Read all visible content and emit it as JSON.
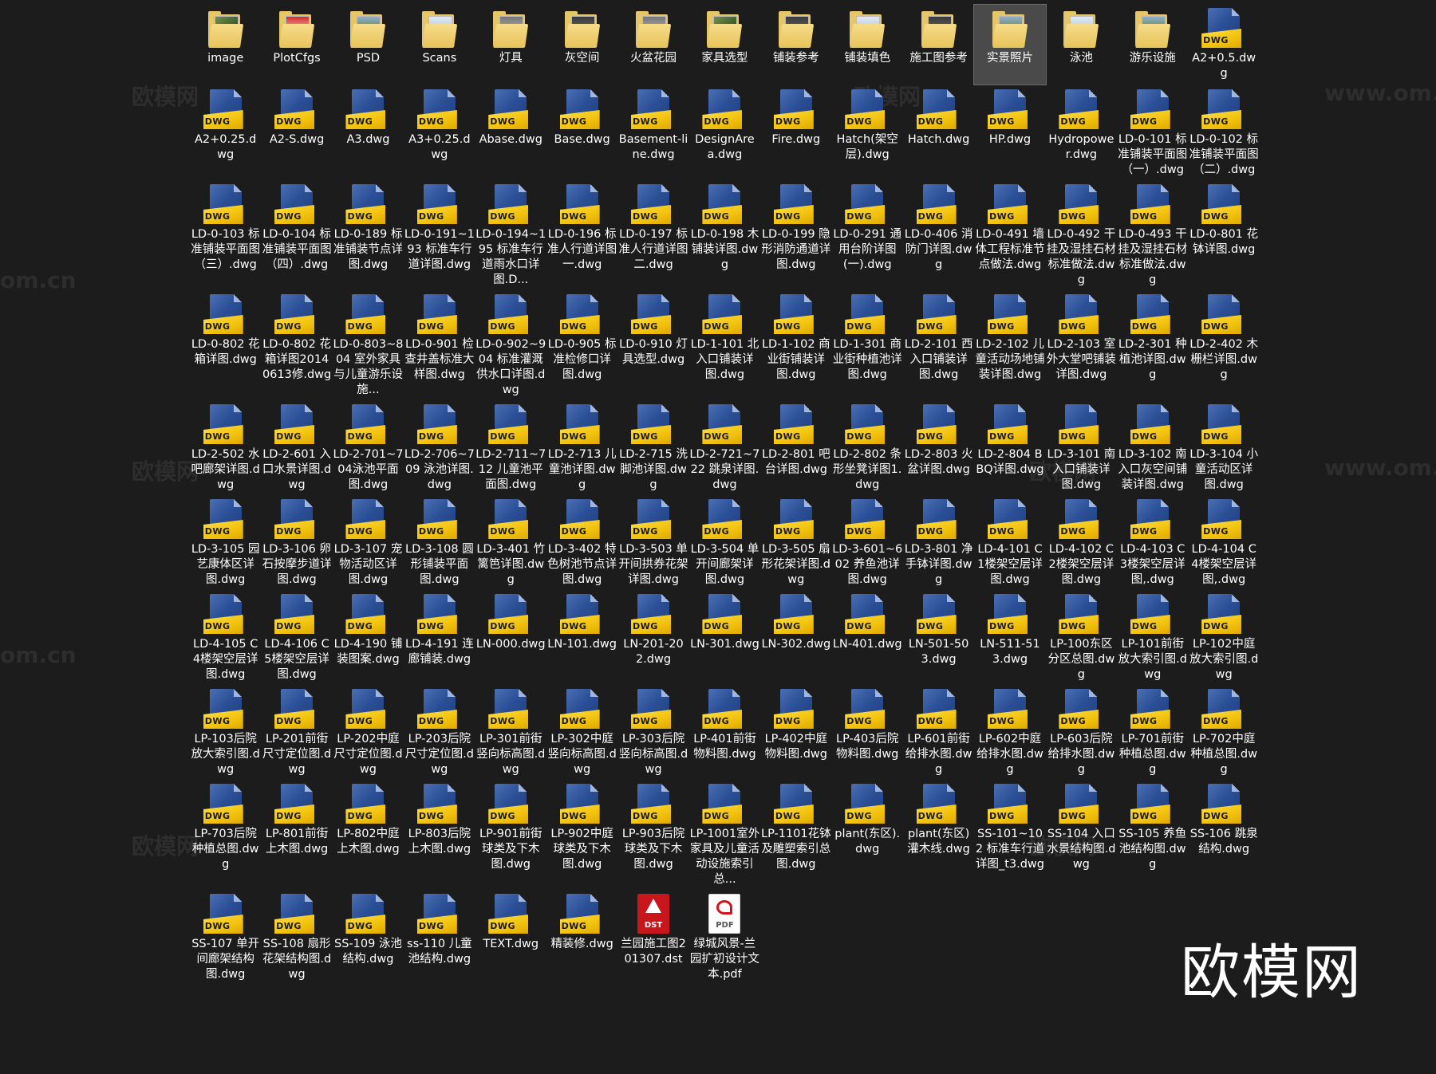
{
  "watermarks": [
    "欧模网",
    "www.om.cn",
    "om.cn"
  ],
  "brand_logo_text": "欧模网",
  "files": [
    {
      "name": "image",
      "type": "folder",
      "thumb": "green"
    },
    {
      "name": "PlotCfgs",
      "type": "folder",
      "thumb": "red"
    },
    {
      "name": "PSD",
      "type": "folder",
      "thumb": "photo"
    },
    {
      "name": "Scans",
      "type": "folder",
      "thumb": "blue"
    },
    {
      "name": "灯具",
      "type": "folder",
      "thumb": "gray"
    },
    {
      "name": "灰空间",
      "type": "folder",
      "thumb": "dark"
    },
    {
      "name": "火盆花园",
      "type": "folder",
      "thumb": "gray"
    },
    {
      "name": "家具选型",
      "type": "folder",
      "thumb": "green"
    },
    {
      "name": "铺装参考",
      "type": "folder",
      "thumb": "dark"
    },
    {
      "name": "铺装填色",
      "type": "folder",
      "thumb": "blue"
    },
    {
      "name": "施工图参考",
      "type": "folder",
      "thumb": "dark"
    },
    {
      "name": "实景照片",
      "type": "folder",
      "thumb": "photo",
      "selected": true
    },
    {
      "name": "泳池",
      "type": "folder",
      "thumb": "blue"
    },
    {
      "name": "游乐设施",
      "type": "folder",
      "thumb": "photo"
    },
    {
      "name": "A2+0.5.dwg",
      "type": "dwg"
    },
    {
      "name": "A2+0.25.dwg",
      "type": "dwg"
    },
    {
      "name": "A2-S.dwg",
      "type": "dwg"
    },
    {
      "name": "A3.dwg",
      "type": "dwg"
    },
    {
      "name": "A3+0.25.dwg",
      "type": "dwg"
    },
    {
      "name": "Abase.dwg",
      "type": "dwg"
    },
    {
      "name": "Base.dwg",
      "type": "dwg"
    },
    {
      "name": "Basement-line.dwg",
      "type": "dwg"
    },
    {
      "name": "DesignArea.dwg",
      "type": "dwg"
    },
    {
      "name": "Fire.dwg",
      "type": "dwg"
    },
    {
      "name": "Hatch(架空层).dwg",
      "type": "dwg"
    },
    {
      "name": "Hatch.dwg",
      "type": "dwg"
    },
    {
      "name": "HP.dwg",
      "type": "dwg"
    },
    {
      "name": "Hydropower.dwg",
      "type": "dwg"
    },
    {
      "name": "LD-0-101 标准铺装平面图（一）.dwg",
      "type": "dwg"
    },
    {
      "name": "LD-0-102 标准铺装平面图（二）.dwg",
      "type": "dwg"
    },
    {
      "name": "LD-0-103 标准铺装平面图（三）.dwg",
      "type": "dwg"
    },
    {
      "name": "LD-0-104 标准铺装平面图（四）.dwg",
      "type": "dwg"
    },
    {
      "name": "LD-0-189 标准铺装节点详图.dwg",
      "type": "dwg"
    },
    {
      "name": "LD-0-191~193 标准车行道详图.dwg",
      "type": "dwg"
    },
    {
      "name": "LD-0-194~195 标准车行道雨水口详图.D...",
      "type": "dwg"
    },
    {
      "name": "LD-0-196 标准人行道详图一.dwg",
      "type": "dwg"
    },
    {
      "name": "LD-0-197 标准人行道详图二.dwg",
      "type": "dwg"
    },
    {
      "name": "LD-0-198 木铺装详图.dwg",
      "type": "dwg"
    },
    {
      "name": "LD-0-199 隐形消防通道详图.dwg",
      "type": "dwg"
    },
    {
      "name": "LD-0-291 通用台阶详图(一).dwg",
      "type": "dwg"
    },
    {
      "name": "LD-0-406 消防门详图.dwg",
      "type": "dwg"
    },
    {
      "name": "LD-0-491 墙体工程标准节点做法.dwg",
      "type": "dwg"
    },
    {
      "name": "LD-0-492 干挂及湿挂石材标准做法.dwg",
      "type": "dwg"
    },
    {
      "name": "LD-0-493 干挂及湿挂石材标准做法.dwg",
      "type": "dwg"
    },
    {
      "name": "LD-0-801 花钵详图.dwg",
      "type": "dwg"
    },
    {
      "name": "LD-0-802 花箱详图.dwg",
      "type": "dwg"
    },
    {
      "name": "LD-0-802 花箱详图20140613修.dwg",
      "type": "dwg"
    },
    {
      "name": "LD-0-803~804 室外家具与儿童游乐设施...",
      "type": "dwg"
    },
    {
      "name": "LD-0-901 检查井盖标准大样图.dwg",
      "type": "dwg"
    },
    {
      "name": "LD-0-902~904 标准灌溉供水口详图.dwg",
      "type": "dwg"
    },
    {
      "name": "LD-0-905 标准检修口详图.dwg",
      "type": "dwg"
    },
    {
      "name": "LD-0-910 灯具选型.dwg",
      "type": "dwg"
    },
    {
      "name": "LD-1-101 北入口铺装详图.dwg",
      "type": "dwg"
    },
    {
      "name": "LD-1-102 商业街铺装详图.dwg",
      "type": "dwg"
    },
    {
      "name": "LD-1-301 商业街种植池详图.dwg",
      "type": "dwg"
    },
    {
      "name": "LD-2-101 西入口铺装详图.dwg",
      "type": "dwg"
    },
    {
      "name": "LD-2-102 儿童活动场地铺装详图.dwg",
      "type": "dwg"
    },
    {
      "name": "LD-2-103 室外大堂吧铺装详图.dwg",
      "type": "dwg"
    },
    {
      "name": "LD-2-301 种植池详图.dwg",
      "type": "dwg"
    },
    {
      "name": "LD-2-402 木栅栏详图.dwg",
      "type": "dwg"
    },
    {
      "name": "LD-2-502 水吧廊架详图.dwg",
      "type": "dwg"
    },
    {
      "name": "LD-2-601 入口水景详图.dwg",
      "type": "dwg"
    },
    {
      "name": "LD-2-701~704泳池平面图.dwg",
      "type": "dwg"
    },
    {
      "name": "LD-2-706~709 泳池详图.dwg",
      "type": "dwg"
    },
    {
      "name": "LD-2-711~712 儿童池平面图.dwg",
      "type": "dwg"
    },
    {
      "name": "LD-2-713 儿童池详图.dwg",
      "type": "dwg"
    },
    {
      "name": "LD-2-715 洗脚池详图.dwg",
      "type": "dwg"
    },
    {
      "name": "LD-2-721~722 跳泉详图.dwg",
      "type": "dwg"
    },
    {
      "name": "LD-2-801 吧台详图.dwg",
      "type": "dwg"
    },
    {
      "name": "LD-2-802 条形坐凳详图1.dwg",
      "type": "dwg"
    },
    {
      "name": "LD-2-803 火盆详图.dwg",
      "type": "dwg"
    },
    {
      "name": "LD-2-804 BBQ详图.dwg",
      "type": "dwg"
    },
    {
      "name": "LD-3-101 南入口铺装详图.dwg",
      "type": "dwg"
    },
    {
      "name": "LD-3-102 南入口灰空间铺装详图.dwg",
      "type": "dwg"
    },
    {
      "name": "LD-3-104 小童活动区详图.dwg",
      "type": "dwg"
    },
    {
      "name": "LD-3-105 园艺康体区详图.dwg",
      "type": "dwg"
    },
    {
      "name": "LD-3-106 卵石按摩步道详图.dwg",
      "type": "dwg"
    },
    {
      "name": "LD-3-107 宠物活动区详图.dwg",
      "type": "dwg"
    },
    {
      "name": "LD-3-108 圆形铺装平面图.dwg",
      "type": "dwg"
    },
    {
      "name": "LD-3-401 竹篱笆详图.dwg",
      "type": "dwg"
    },
    {
      "name": "LD-3-402 特色树池节点详图.dwg",
      "type": "dwg"
    },
    {
      "name": "LD-3-503 单开间拱券花架详图.dwg",
      "type": "dwg"
    },
    {
      "name": "LD-3-504 单开间廊架详图.dwg",
      "type": "dwg"
    },
    {
      "name": "LD-3-505 扇形花架详图.dwg",
      "type": "dwg"
    },
    {
      "name": "LD-3-601~602 养鱼池详图.dwg",
      "type": "dwg"
    },
    {
      "name": "LD-3-801 净手钵详图.dwg",
      "type": "dwg"
    },
    {
      "name": "LD-4-101 C1楼架空层详图.dwg",
      "type": "dwg"
    },
    {
      "name": "LD-4-102 C2楼架空层详图.dwg",
      "type": "dwg"
    },
    {
      "name": "LD-4-103 C3楼架空层详图,.dwg",
      "type": "dwg"
    },
    {
      "name": "LD-4-104 C4楼架空层详图,.dwg",
      "type": "dwg"
    },
    {
      "name": "LD-4-105 C4楼架空层详图.dwg",
      "type": "dwg"
    },
    {
      "name": "LD-4-106 C5楼架空层详图.dwg",
      "type": "dwg"
    },
    {
      "name": "LD-4-190 铺装图案.dwg",
      "type": "dwg"
    },
    {
      "name": "LD-4-191 连廊铺装.dwg",
      "type": "dwg"
    },
    {
      "name": "LN-000.dwg",
      "type": "dwg"
    },
    {
      "name": "LN-101.dwg",
      "type": "dwg"
    },
    {
      "name": "LN-201-202.dwg",
      "type": "dwg"
    },
    {
      "name": "LN-301.dwg",
      "type": "dwg"
    },
    {
      "name": "LN-302.dwg",
      "type": "dwg"
    },
    {
      "name": "LN-401.dwg",
      "type": "dwg"
    },
    {
      "name": "LN-501-503.dwg",
      "type": "dwg"
    },
    {
      "name": "LN-511-513.dwg",
      "type": "dwg"
    },
    {
      "name": "LP-100东区分区总图.dwg",
      "type": "dwg"
    },
    {
      "name": "LP-101前街放大索引图.dwg",
      "type": "dwg"
    },
    {
      "name": "LP-102中庭放大索引图.dwg",
      "type": "dwg"
    },
    {
      "name": "LP-103后院放大索引图.dwg",
      "type": "dwg"
    },
    {
      "name": "LP-201前街尺寸定位图.dwg",
      "type": "dwg"
    },
    {
      "name": "LP-202中庭尺寸定位图.dwg",
      "type": "dwg"
    },
    {
      "name": "LP-203后院尺寸定位图.dwg",
      "type": "dwg"
    },
    {
      "name": "LP-301前街竖向标高图.dwg",
      "type": "dwg"
    },
    {
      "name": "LP-302中庭竖向标高图.dwg",
      "type": "dwg"
    },
    {
      "name": "LP-303后院竖向标高图.dwg",
      "type": "dwg"
    },
    {
      "name": "LP-401前街物料图.dwg",
      "type": "dwg"
    },
    {
      "name": "LP-402中庭物料图.dwg",
      "type": "dwg"
    },
    {
      "name": "LP-403后院物料图.dwg",
      "type": "dwg"
    },
    {
      "name": "LP-601前街给排水图.dwg",
      "type": "dwg"
    },
    {
      "name": "LP-602中庭给排水图.dwg",
      "type": "dwg"
    },
    {
      "name": "LP-603后院给排水图.dwg",
      "type": "dwg"
    },
    {
      "name": "LP-701前街种植总图.dwg",
      "type": "dwg"
    },
    {
      "name": "LP-702中庭种植总图.dwg",
      "type": "dwg"
    },
    {
      "name": "LP-703后院种植总图.dwg",
      "type": "dwg"
    },
    {
      "name": "LP-801前街上木图.dwg",
      "type": "dwg"
    },
    {
      "name": "LP-802中庭上木图.dwg",
      "type": "dwg"
    },
    {
      "name": "LP-803后院上木图.dwg",
      "type": "dwg"
    },
    {
      "name": "LP-901前街球类及下木图.dwg",
      "type": "dwg"
    },
    {
      "name": "LP-902中庭球类及下木图.dwg",
      "type": "dwg"
    },
    {
      "name": "LP-903后院球类及下木图.dwg",
      "type": "dwg"
    },
    {
      "name": "LP-1001室外家具及儿童活动设施索引总...",
      "type": "dwg"
    },
    {
      "name": "LP-1101花钵及雕塑索引总图.dwg",
      "type": "dwg"
    },
    {
      "name": "plant(东区).dwg",
      "type": "dwg"
    },
    {
      "name": "plant(东区)灌木线.dwg",
      "type": "dwg"
    },
    {
      "name": "SS-101~102 标准车行道详图_t3.dwg",
      "type": "dwg"
    },
    {
      "name": "SS-104 入口水景结构图.dwg",
      "type": "dwg"
    },
    {
      "name": "SS-105 养鱼池结构图.dwg",
      "type": "dwg"
    },
    {
      "name": "SS-106 跳泉结构.dwg",
      "type": "dwg"
    },
    {
      "name": "SS-107 单开间廊架结构图.dwg",
      "type": "dwg"
    },
    {
      "name": "SS-108 扇形花架结构图.dwg",
      "type": "dwg"
    },
    {
      "name": "SS-109 泳池结构.dwg",
      "type": "dwg"
    },
    {
      "name": "ss-110 儿童池结构.dwg",
      "type": "dwg"
    },
    {
      "name": "TEXT.dwg",
      "type": "dwg"
    },
    {
      "name": "精装修.dwg",
      "type": "dwg"
    },
    {
      "name": "兰园施工图201307.dst",
      "type": "dst"
    },
    {
      "name": "绿城风景-兰园扩初设计文本.pdf",
      "type": "pdf"
    }
  ],
  "icon_labels": {
    "dwg": "DWG",
    "dst": "DST",
    "pdf": "PDF"
  },
  "colors": {
    "background": "#1c1c1c",
    "selection": "#4a4a4a",
    "dwg_blue": "#2b4f96",
    "dwg_yellow": "#f2c30e"
  }
}
